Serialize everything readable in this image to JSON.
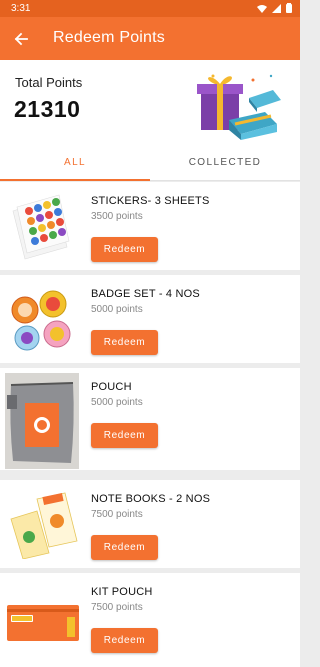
{
  "status_bar": {
    "time": "3:31"
  },
  "app_bar": {
    "title": "Redeem Points"
  },
  "points": {
    "label": "Total Points",
    "value": "21310"
  },
  "tabs": [
    {
      "label": "ALL",
      "active": true
    },
    {
      "label": "COLLECTED",
      "active": false
    }
  ],
  "items": [
    {
      "name": "STICKERS- 3 SHEETS",
      "points": "3500 points",
      "button": "Redeem",
      "icon": "stickers-image"
    },
    {
      "name": "BADGE SET - 4 NOS",
      "points": "5000 points",
      "button": "Redeem",
      "icon": "badges-image"
    },
    {
      "name": "POUCH",
      "points": "5000 points",
      "button": "Redeem",
      "icon": "pouch-image"
    },
    {
      "name": "NOTE BOOKS - 2 NOS",
      "points": "7500 points",
      "button": "Redeem",
      "icon": "notebooks-image"
    },
    {
      "name": "KIT POUCH",
      "points": "7500 points",
      "button": "Redeem",
      "icon": "kit-pouch-image"
    }
  ],
  "colors": {
    "primary": "#f37130",
    "status_bar": "#e5621f",
    "background": "#ececec"
  }
}
